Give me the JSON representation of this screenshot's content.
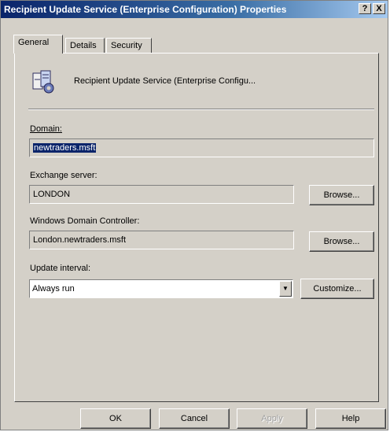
{
  "window": {
    "title": "Recipient Update Service (Enterprise Configuration) Properties",
    "help_btn": "?",
    "close_btn": "X"
  },
  "tabs": [
    {
      "label": "General",
      "active": true
    },
    {
      "label": "Details",
      "active": false
    },
    {
      "label": "Security",
      "active": false
    }
  ],
  "service": {
    "icon": "recipient-update-service-icon",
    "name": "Recipient Update Service (Enterprise Configu..."
  },
  "domain": {
    "label": "Domain:",
    "value": "newtraders.msft"
  },
  "exchange_server": {
    "label": "Exchange server:",
    "value": "LONDON",
    "browse": "Browse..."
  },
  "domain_controller": {
    "label": "Windows Domain Controller:",
    "value": "London.newtraders.msft",
    "browse": "Browse..."
  },
  "update_interval": {
    "label": "Update interval:",
    "value": "Always run",
    "customize": "Customize..."
  },
  "buttons": {
    "ok": "OK",
    "cancel": "Cancel",
    "apply": "Apply",
    "help": "Help"
  },
  "colors": {
    "titlebar": "#0a246a",
    "face": "#d4d0c8",
    "selection": "#0a246a"
  }
}
